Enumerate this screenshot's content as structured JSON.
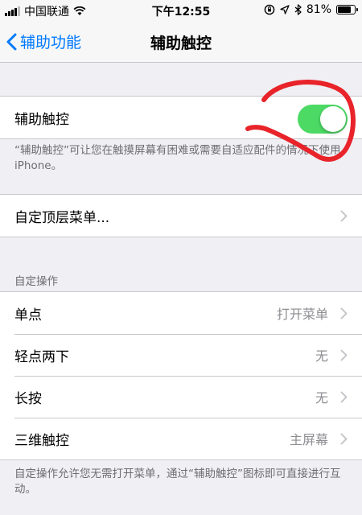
{
  "status_bar": {
    "carrier": "中国联通",
    "time": "下午12:55",
    "battery": "81%"
  },
  "nav": {
    "back_label": "辅助功能",
    "title": "辅助触控"
  },
  "assistive_touch": {
    "label": "辅助触控",
    "enabled": true,
    "footer": "“辅助触控”可让您在触摸屏幕有困难或需要自适应配件的情况下使用 iPhone。"
  },
  "top_menu": {
    "label": "自定顶层菜单..."
  },
  "custom_actions": {
    "header": "自定操作",
    "rows": [
      {
        "label": "单点",
        "value": "打开菜单"
      },
      {
        "label": "轻点两下",
        "value": "无"
      },
      {
        "label": "长按",
        "value": "无"
      },
      {
        "label": "三维触控",
        "value": "主屏幕"
      }
    ],
    "footer": "自定操作允许您无需打开菜单，通过“辅助触控”图标即可直接进行互动。"
  },
  "colors": {
    "accent": "#007aff",
    "toggle_on": "#4cd964",
    "annotation": "#e8242a"
  },
  "icons": [
    "signal-bars-icon",
    "wifi-icon",
    "orientation-lock-icon",
    "location-icon",
    "bluetooth-icon",
    "battery-icon",
    "chevron-left-icon",
    "chevron-right-icon"
  ]
}
